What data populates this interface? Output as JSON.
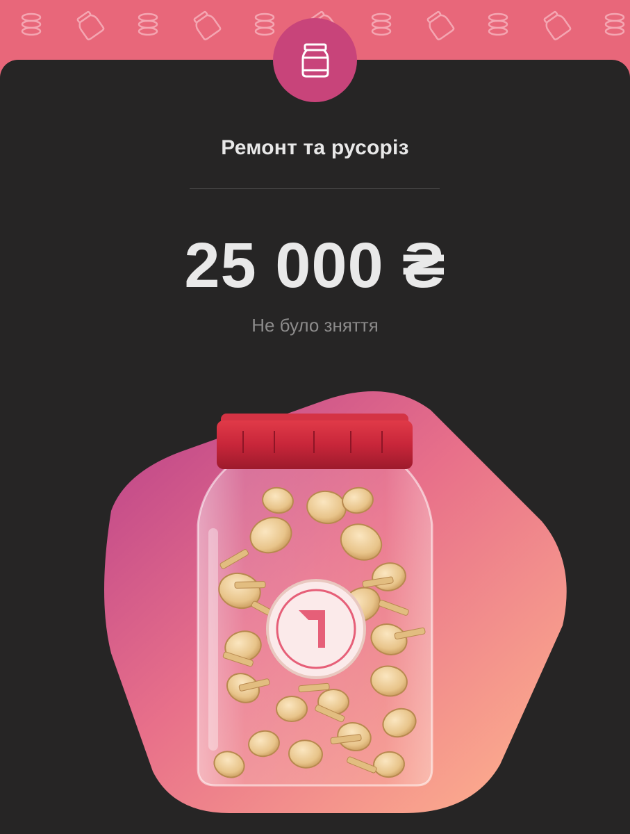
{
  "jar": {
    "title": "Ремонт та русоріз",
    "amount": "25 000 ₴",
    "status": "Не було зняття",
    "badge_icon": "jar-icon",
    "illustration_icon": "jar-with-coins-illustration",
    "logo_icon": "monobank-cat-logo-icon"
  },
  "colors": {
    "header_pink": "#e8677a",
    "card_dark": "#262525",
    "badge_magenta": "#c8447a",
    "lid_red": "#c8263a",
    "blob_start": "#c54b8c",
    "blob_end": "#ffb08c",
    "coin_gold": "#e9c98f"
  }
}
